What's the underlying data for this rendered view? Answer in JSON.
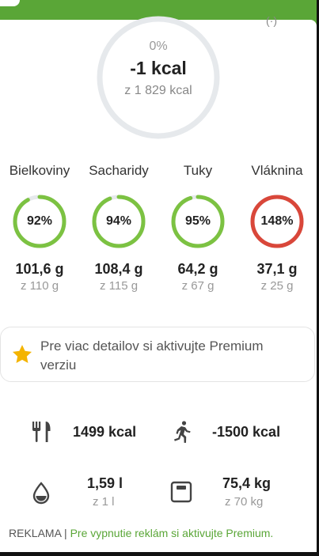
{
  "header": {
    "paren_fragment": "(·)"
  },
  "summary": {
    "percent": "0%",
    "value": "-1 kcal",
    "target": "z 1 829 kcal",
    "progress": 0
  },
  "macros": [
    {
      "label": "Bielkoviny",
      "percent": "92%",
      "value": "101,6 g",
      "target": "z 110 g",
      "progress": 0.92,
      "color": "#7cc242"
    },
    {
      "label": "Sacharidy",
      "percent": "94%",
      "value": "108,4 g",
      "target": "z 115 g",
      "progress": 0.94,
      "color": "#7cc242"
    },
    {
      "label": "Tuky",
      "percent": "95%",
      "value": "64,2 g",
      "target": "z 67 g",
      "progress": 0.95,
      "color": "#7cc242"
    },
    {
      "label": "Vláknina",
      "percent": "148%",
      "value": "37,1 g",
      "target": "z 25 g",
      "progress": 1.0,
      "color": "#d9473a"
    }
  ],
  "premium": {
    "text": "Pre viac detailov si aktivujte Premium verziu",
    "icon": "star-icon",
    "star_color": "#f4b400"
  },
  "stats": {
    "food": {
      "icon": "fork-knife-icon",
      "value": "1499 kcal"
    },
    "exercise": {
      "icon": "running-icon",
      "value": "-1500 kcal"
    },
    "water": {
      "icon": "water-drop-icon",
      "value": "1,59 l",
      "target": "z 1 l"
    },
    "weight": {
      "icon": "scale-icon",
      "value": "75,4 kg",
      "target": "z 70 kg"
    }
  },
  "ad": {
    "label": "REKLAMA",
    "separator": "|",
    "link": "Pre vypnutie reklám si aktivujte Premium."
  },
  "colors": {
    "accent": "#5aa637",
    "ring_track": "#e6e9ec",
    "over": "#d9473a"
  }
}
